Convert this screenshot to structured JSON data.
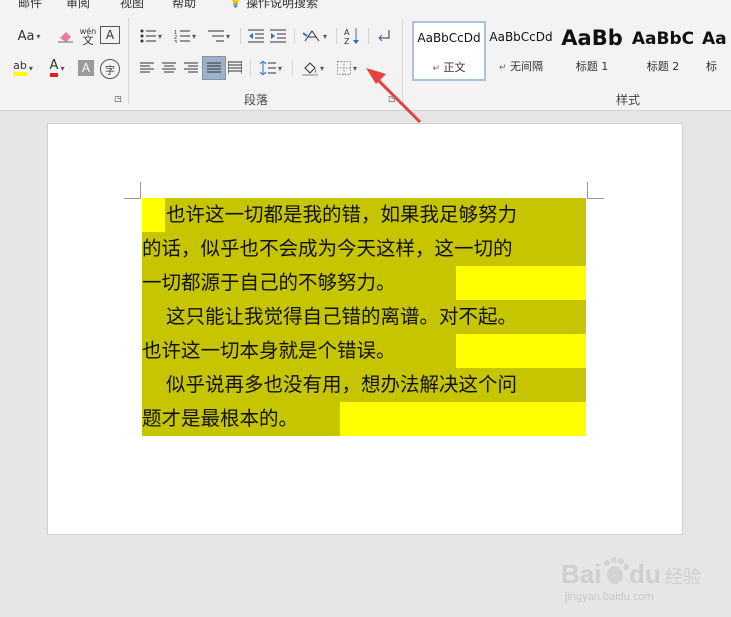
{
  "menu": [
    "邮件",
    "审阅",
    "视图",
    "帮助",
    "操作说明搜索"
  ],
  "font_group": {
    "change_case": "Aa",
    "clear_format_icon": "eraser-icon",
    "phonetic_top": "wén",
    "phonetic_bottom": "文",
    "char_border": "A",
    "highlight_icon": "ab-highlight-icon",
    "font_color_label": "A",
    "char_shading": "A",
    "enclose_char": "字"
  },
  "paragraph_group": {
    "label": "段落"
  },
  "styles_group": {
    "label": "样式",
    "styles": [
      {
        "sample": "AaBbCcDd",
        "name": "正文",
        "selected": true
      },
      {
        "sample": "AaBbCcDd",
        "name": "无间隔",
        "selected": false
      },
      {
        "sample": "AaBb",
        "name": "标题 1",
        "selected": false
      },
      {
        "sample": "AaBbC",
        "name": "标题 2",
        "selected": false
      },
      {
        "sample": "Aa",
        "name": "标",
        "selected": false
      }
    ]
  },
  "document": {
    "paragraphs": [
      {
        "lines": [
          "也许这一切都是我的错，如果我足够努力",
          "的话，似乎也不会成为今天这样，这一切的",
          "一切都源于自己的不够努力。"
        ]
      },
      {
        "lines": [
          "这只能让我觉得自己错的离谱。对不起。",
          "也许这一切本身就是个错误。"
        ]
      },
      {
        "lines": [
          "似乎说再多也没有用，想办法解决这个问",
          "题才是最根本的。"
        ]
      }
    ]
  },
  "colors": {
    "highlight_dark": "#c7c500",
    "highlight_yellow": "#ffff00",
    "arrow": "#e8403c",
    "font_color_bar": "#e02020",
    "highlight_bar": "#ffff00"
  },
  "watermark": {
    "brand": "Baidu 经验",
    "url": "jingyan.baidu.com"
  }
}
